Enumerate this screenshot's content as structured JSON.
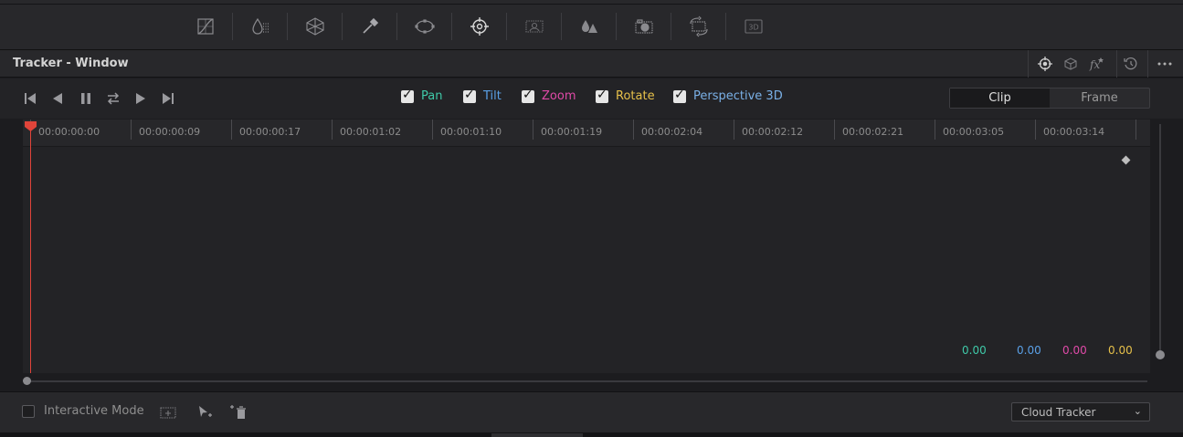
{
  "header": {
    "title": "Tracker - Window"
  },
  "tracking": {
    "options": [
      {
        "label": "Pan",
        "color": "#3fc9a8",
        "checked": true
      },
      {
        "label": "Tilt",
        "color": "#5aa0e6",
        "checked": true
      },
      {
        "label": "Zoom",
        "color": "#e04aa8",
        "checked": true
      },
      {
        "label": "Rotate",
        "color": "#e6c04a",
        "checked": true
      },
      {
        "label": "Perspective 3D",
        "color": "#7ab0e6",
        "checked": true
      }
    ],
    "mode": {
      "clip": "Clip",
      "frame": "Frame",
      "selected": "Clip"
    }
  },
  "timeline": {
    "timecodes": [
      "00:00:00:00",
      "00:00:00:09",
      "00:00:00:17",
      "00:00:01:02",
      "00:00:01:10",
      "00:00:01:19",
      "00:00:02:04",
      "00:00:02:12",
      "00:00:02:21",
      "00:00:03:05",
      "00:00:03:14"
    ]
  },
  "values": [
    {
      "value": "0.00",
      "color": "#3fc9a8"
    },
    {
      "value": "0.00",
      "color": "#5aa0e6"
    },
    {
      "value": "0.00",
      "color": "#e04aa8"
    },
    {
      "value": "0.00",
      "color": "#e6c04a"
    }
  ],
  "footer": {
    "interactive_mode_label": "Interactive Mode",
    "interactive_mode_checked": false,
    "tracker_type": "Cloud Tracker"
  },
  "icons": {
    "palette": [
      "curves-icon",
      "qualifier-icon",
      "color-warper-icon",
      "picker-icon",
      "window-icon",
      "tracker-icon",
      "magic-mask-icon",
      "blur-icon",
      "key-icon",
      "sizing-icon",
      "3d-icon"
    ],
    "header": [
      "tracker-crosshair-icon",
      "stabilizer-icon",
      "fx-icon",
      "reset-icon",
      "more-options-icon"
    ]
  }
}
